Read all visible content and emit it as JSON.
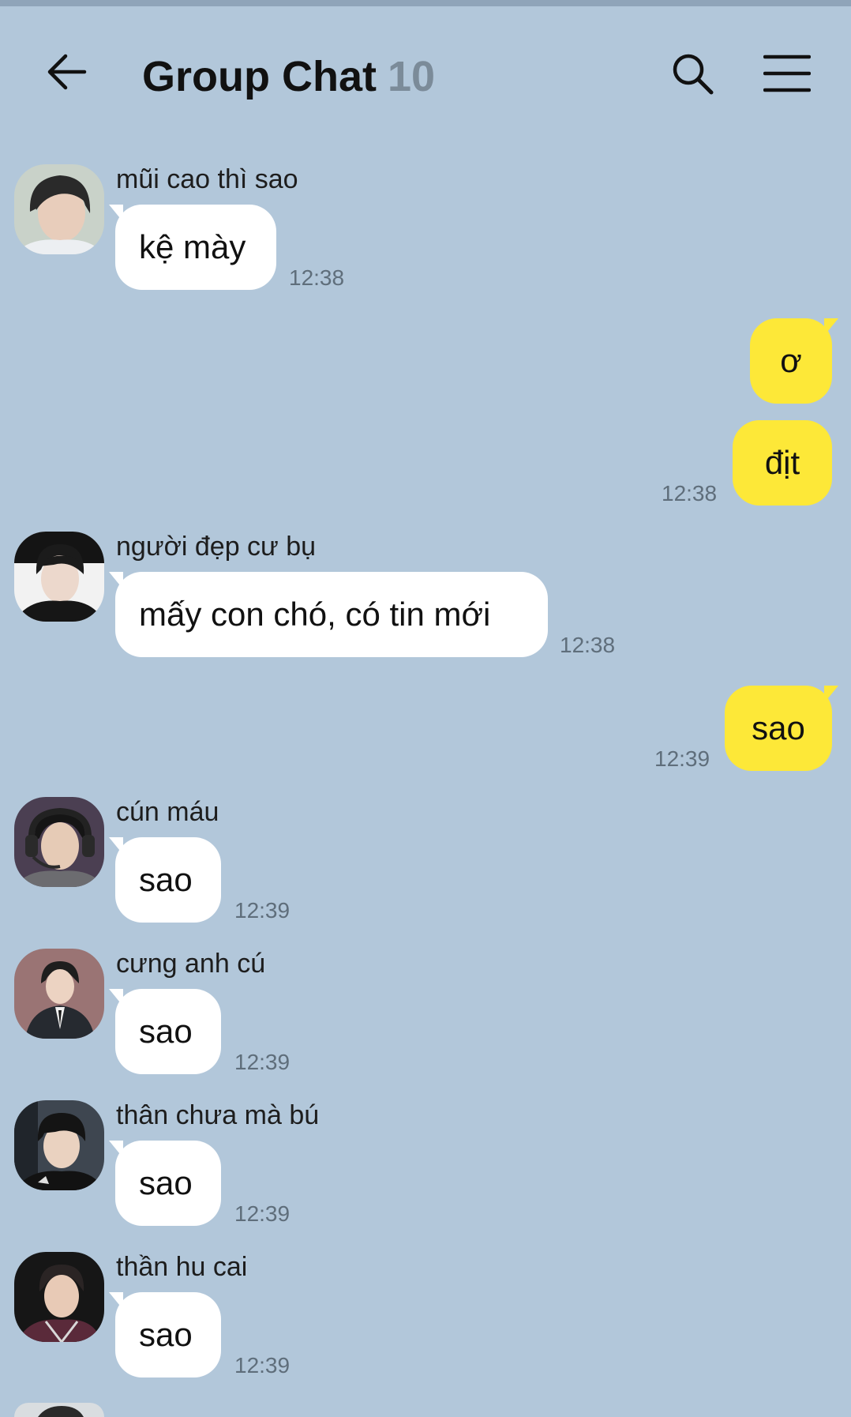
{
  "header": {
    "title": "Group Chat",
    "member_count": "10",
    "icons": {
      "back": "arrow-left-icon",
      "search": "search-icon",
      "menu": "hamburger-menu-icon"
    }
  },
  "messages": [
    {
      "sender": "mũi cao thì sao",
      "text": "kệ mày",
      "time": "12:38",
      "direction": "incoming"
    },
    {
      "text": "ơ",
      "direction": "outgoing"
    },
    {
      "text": "địt",
      "time": "12:38",
      "direction": "outgoing"
    },
    {
      "sender": "người đẹp cư bụ",
      "text": "mấy con chó, có tin mới",
      "time": "12:38",
      "direction": "incoming"
    },
    {
      "text": "sao",
      "time": "12:39",
      "direction": "outgoing"
    },
    {
      "sender": "cún máu",
      "text": "sao",
      "time": "12:39",
      "direction": "incoming"
    },
    {
      "sender": "cưng anh cú",
      "text": "sao",
      "time": "12:39",
      "direction": "incoming"
    },
    {
      "sender": "thân chưa mà bú",
      "text": "sao",
      "time": "12:39",
      "direction": "incoming"
    },
    {
      "sender": "thần hu cai",
      "text": "sao",
      "time": "12:39",
      "direction": "incoming"
    }
  ],
  "colors": {
    "background": "#b2c7da",
    "incoming_bubble": "#ffffff",
    "outgoing_bubble": "#fde838",
    "member_count": "#7b8b99",
    "timestamp": "#5f6e7b"
  }
}
